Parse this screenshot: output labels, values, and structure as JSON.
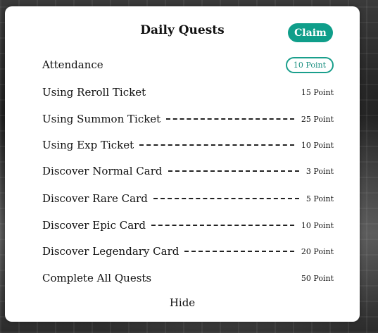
{
  "dialog": {
    "title": "Daily Quests",
    "claim_label": "Claim",
    "hide_label": "Hide",
    "accent_color": "#0f9e8a"
  },
  "quests": [
    {
      "label": "Attendance",
      "points": "10 Point",
      "claimable": true
    },
    {
      "label": "Using Reroll Ticket",
      "points": "15 Point",
      "claimable": false
    },
    {
      "label": "Using Summon Ticket",
      "points": "25 Point",
      "claimable": false
    },
    {
      "label": "Using Exp Ticket",
      "points": "10 Point",
      "claimable": false
    },
    {
      "label": "Discover Normal Card",
      "points": "3 Point",
      "claimable": false
    },
    {
      "label": "Discover Rare Card",
      "points": "5 Point",
      "claimable": false
    },
    {
      "label": "Discover Epic Card",
      "points": "10 Point",
      "claimable": false
    },
    {
      "label": "Discover Legendary Card",
      "points": "20 Point",
      "claimable": false
    },
    {
      "label": "Complete All Quests",
      "points": "50 Point",
      "claimable": false
    }
  ]
}
